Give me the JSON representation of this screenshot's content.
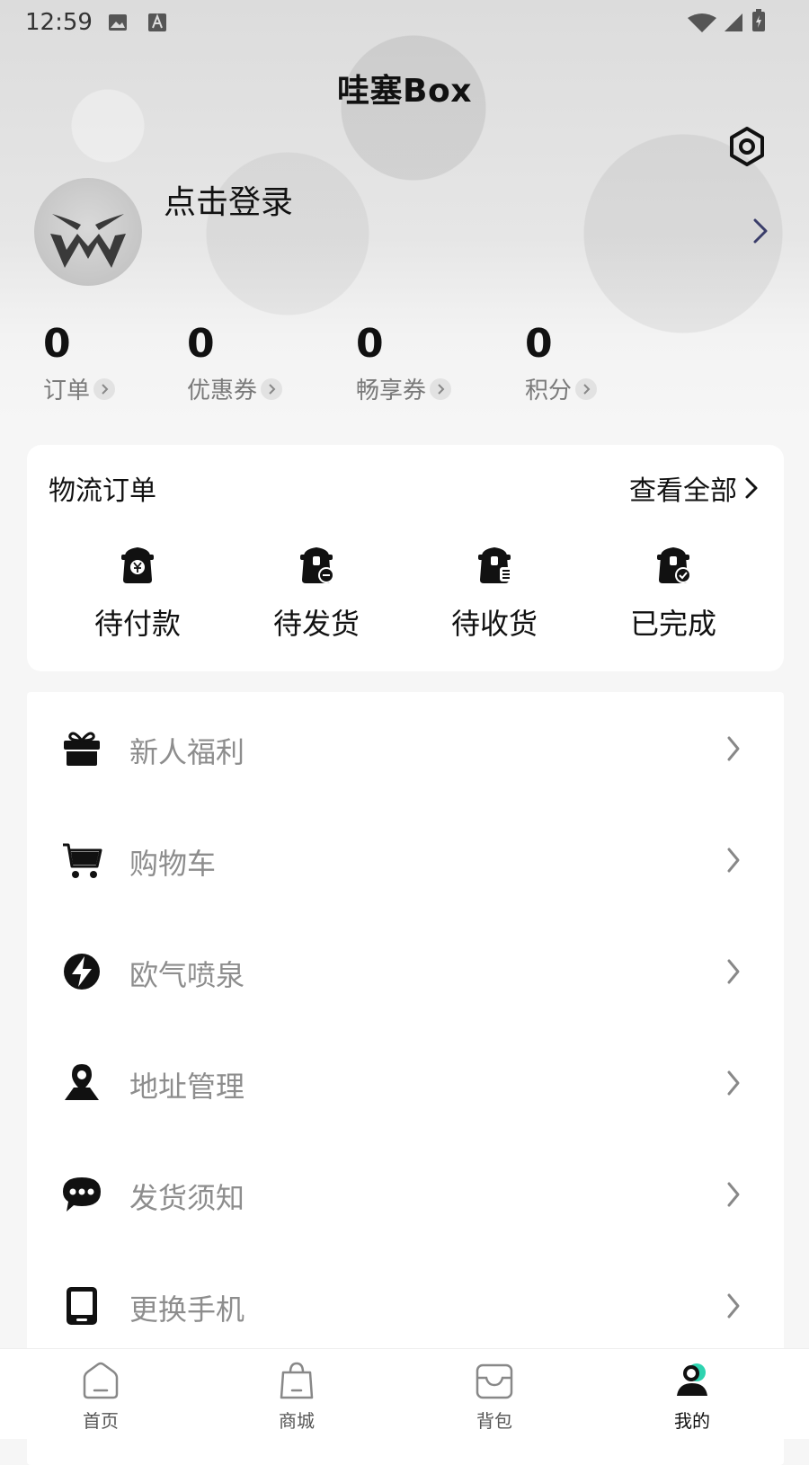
{
  "status_bar": {
    "time": "12:59"
  },
  "header": {
    "title": "哇塞Box"
  },
  "profile": {
    "login_text": "点击登录"
  },
  "stats": [
    {
      "value": "0",
      "label": "订单"
    },
    {
      "value": "0",
      "label": "优惠券"
    },
    {
      "value": "0",
      "label": "畅享券"
    },
    {
      "value": "0",
      "label": "积分"
    }
  ],
  "orders": {
    "title": "物流订单",
    "view_all": "查看全部",
    "items": [
      {
        "label": "待付款",
        "icon": "pending-payment-icon"
      },
      {
        "label": "待发货",
        "icon": "pending-shipment-icon"
      },
      {
        "label": "待收货",
        "icon": "pending-receipt-icon"
      },
      {
        "label": "已完成",
        "icon": "completed-icon"
      }
    ]
  },
  "menu": [
    {
      "label": "新人福利",
      "icon": "gift-icon"
    },
    {
      "label": "购物车",
      "icon": "cart-icon"
    },
    {
      "label": "欧气喷泉",
      "icon": "lightning-icon"
    },
    {
      "label": "地址管理",
      "icon": "location-icon"
    },
    {
      "label": "发货须知",
      "icon": "chat-icon"
    },
    {
      "label": "更换手机",
      "icon": "phone-icon"
    }
  ],
  "tabbar": [
    {
      "label": "首页",
      "icon": "home-icon"
    },
    {
      "label": "商城",
      "icon": "shopping-bag-icon"
    },
    {
      "label": "背包",
      "icon": "inbox-icon"
    },
    {
      "label": "我的",
      "icon": "profile-icon",
      "active": true
    }
  ],
  "colors": {
    "accent": "#2ed3b0",
    "muted_text": "#8d8d8d",
    "card_bg": "#ffffff"
  }
}
